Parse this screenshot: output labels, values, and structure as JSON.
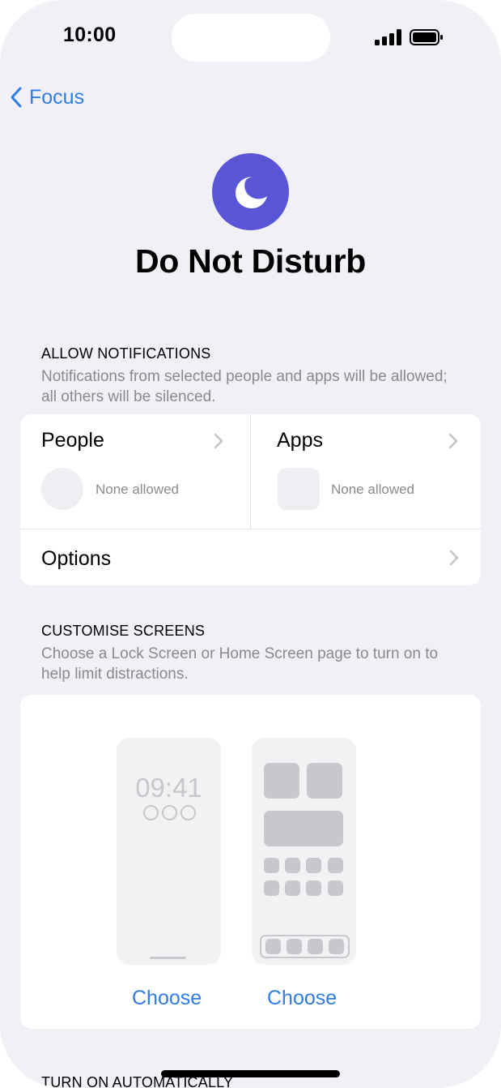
{
  "status_bar": {
    "time": "10:00"
  },
  "nav": {
    "back_label": "Focus"
  },
  "header": {
    "title": "Do Not Disturb"
  },
  "allow_notifications": {
    "heading": "ALLOW NOTIFICATIONS",
    "description": "Notifications from selected people and apps will be allowed; all others will be silenced.",
    "people": {
      "label": "People",
      "status": "None allowed"
    },
    "apps": {
      "label": "Apps",
      "status": "None allowed"
    },
    "options": {
      "label": "Options"
    }
  },
  "customise_screens": {
    "heading": "CUSTOMISE SCREENS",
    "description": "Choose a Lock Screen or Home Screen page to turn on to help limit distractions.",
    "lock_screen_time": "09:41",
    "lock_choose": "Choose",
    "home_choose": "Choose"
  },
  "turn_on_automatically": {
    "heading": "TURN ON AUTOMATICALLY"
  },
  "colors": {
    "accent": "#2f7ce4",
    "focus_icon_bg": "#5856d6",
    "background": "#f1f0f6"
  }
}
